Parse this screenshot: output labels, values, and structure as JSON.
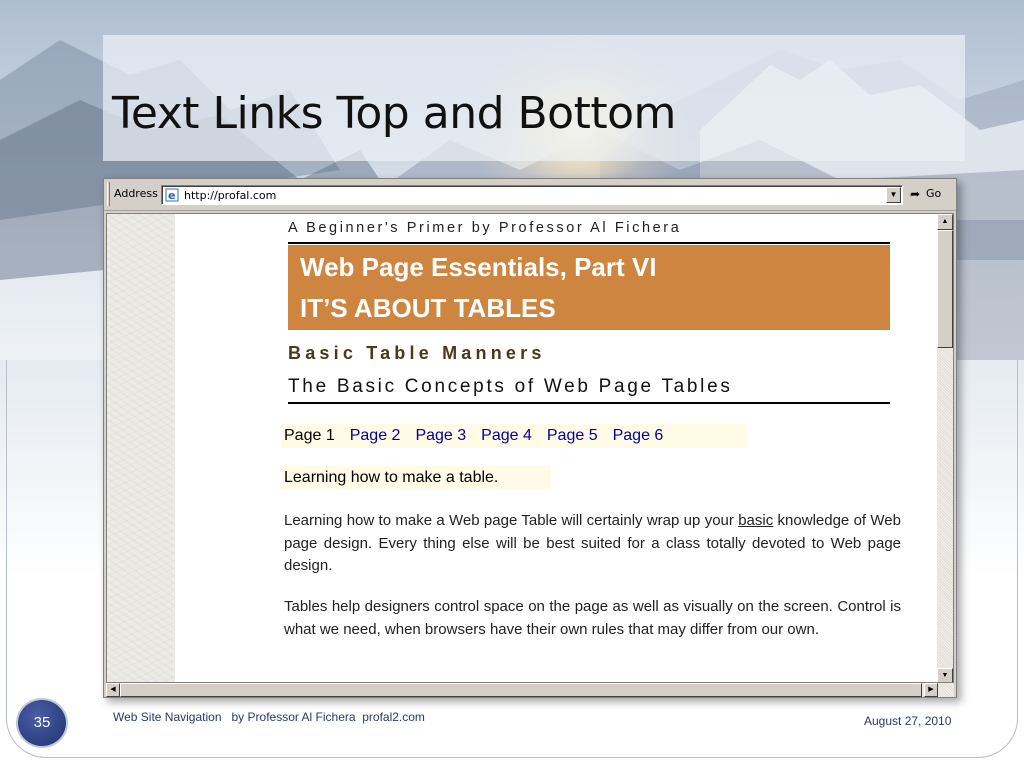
{
  "slide": {
    "title": "Text Links Top and Bottom",
    "page_number": "35",
    "footer_left": "Web Site Navigation   by Professor Al Fichera  profal2.com",
    "footer_right": "August 27, 2010"
  },
  "browser": {
    "address_label": "Address",
    "url": "http://profal.com",
    "go_label": "Go",
    "icons": {
      "ie": "ie-page-icon",
      "dropdown": "chevron-down-icon",
      "go": "go-arrow-icon"
    }
  },
  "page": {
    "byline": "A Beginner's Primer by Professor Al Fichera",
    "banner_line1": "Web Page Essentials, Part VI",
    "banner_line2": "IT’S ABOUT TABLES",
    "banner_color": "#cd853f",
    "section_title": "Basic Table Manners",
    "subtitle": "The Basic Concepts of Web Page Tables",
    "page_links": [
      {
        "label": "Page 1",
        "current": true
      },
      {
        "label": "Page 2",
        "current": false
      },
      {
        "label": "Page 3",
        "current": false
      },
      {
        "label": "Page 4",
        "current": false
      },
      {
        "label": "Page 5",
        "current": false
      },
      {
        "label": "Page 6",
        "current": false
      }
    ],
    "heading": "Learning how to make a table.",
    "para1_before": "Learning how to make a Web page Table will certainly wrap up your ",
    "para1_link": "basic",
    "para1_after": " knowledge of Web page design. Every thing else will be best suited for a class totally devoted to Web page design.",
    "para2": "Tables help designers control space on the page as well as visually on the screen. Control is what we need, when browsers have their own rules that may differ from our own."
  }
}
